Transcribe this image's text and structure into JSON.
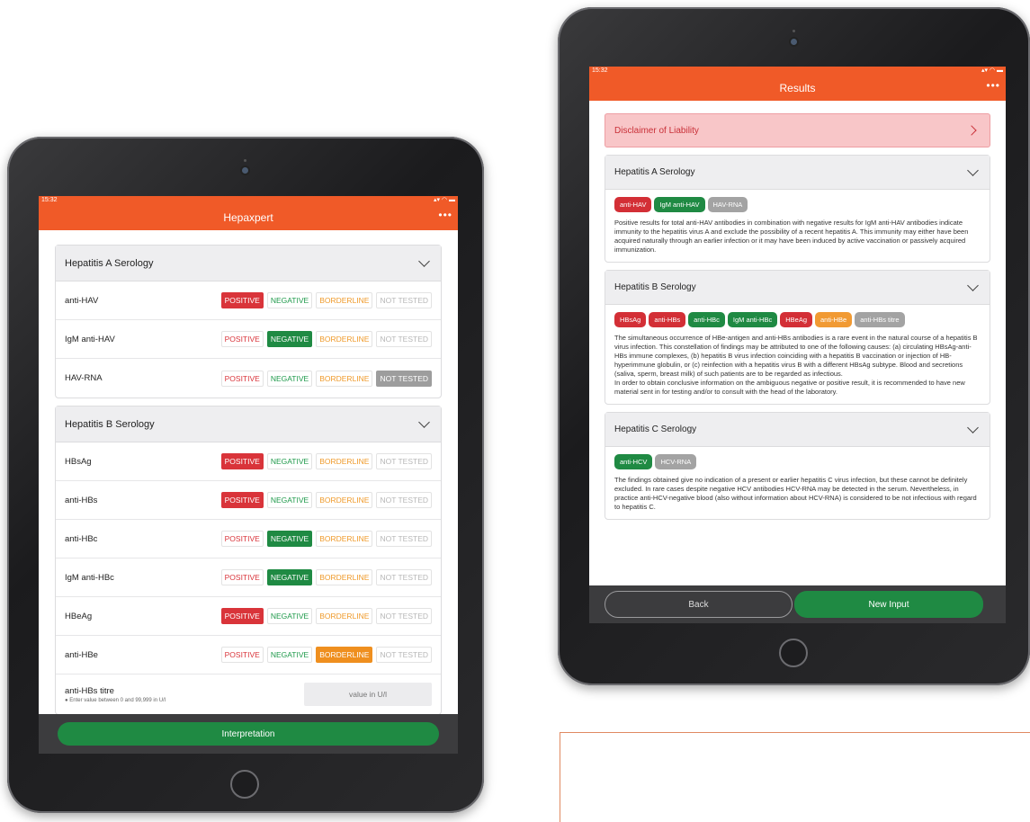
{
  "left_tablet": {
    "status_time": "15:32",
    "status_icons": "▴▾ ◠ ▬",
    "app_title": "Hepaxpert",
    "more_label": "•••",
    "options": [
      "POSITIVE",
      "NEGATIVE",
      "BORDERLINE",
      "NOT TESTED"
    ],
    "sections": [
      {
        "title": "Hepatitis A Serology",
        "rows": [
          {
            "label": "anti-HAV",
            "selected": "POSITIVE"
          },
          {
            "label": "IgM anti-HAV",
            "selected": "NEGATIVE"
          },
          {
            "label": "HAV-RNA",
            "selected": "NOT TESTED"
          }
        ]
      },
      {
        "title": "Hepatitis B Serology",
        "rows": [
          {
            "label": "HBsAg",
            "selected": "POSITIVE"
          },
          {
            "label": "anti-HBs",
            "selected": "POSITIVE"
          },
          {
            "label": "anti-HBc",
            "selected": "NEGATIVE"
          },
          {
            "label": "IgM anti-HBc",
            "selected": "NEGATIVE"
          },
          {
            "label": "HBeAg",
            "selected": "POSITIVE"
          },
          {
            "label": "anti-HBe",
            "selected": "BORDERLINE"
          }
        ],
        "titre": {
          "label": "anti-HBs titre",
          "hint": "Enter value between 0 and 99,999 in U/l",
          "placeholder": "value in U/l"
        }
      }
    ],
    "interpretation_button": "Interpretation"
  },
  "right_tablet": {
    "status_time": "15:32",
    "app_title": "Results",
    "more_label": "•••",
    "disclaimer": "Disclaimer of Liability",
    "results": [
      {
        "title": "Hepatitis A Serology",
        "tags": [
          {
            "text": "anti-HAV",
            "color": "red"
          },
          {
            "text": "IgM anti-HAV",
            "color": "green"
          },
          {
            "text": "HAV-RNA",
            "color": "grey"
          }
        ],
        "text": "Positive results for total anti-HAV antibodies in combination with negative results for IgM anti-HAV antibodies indicate immunity to the hepatitis virus A and exclude the possibility of a recent hepatitis A. This immunity may either have been acquired naturally through an earlier infection or it may have been induced by active vaccination or passively acquired immunization."
      },
      {
        "title": "Hepatitis B Serology",
        "tags": [
          {
            "text": "HBsAg",
            "color": "red"
          },
          {
            "text": "anti-HBs",
            "color": "red"
          },
          {
            "text": "anti-HBc",
            "color": "green"
          },
          {
            "text": "IgM anti-HBc",
            "color": "green"
          },
          {
            "text": "HBeAg",
            "color": "red"
          },
          {
            "text": "anti-HBe",
            "color": "orange"
          },
          {
            "text": "anti-HBs titre",
            "color": "grey"
          }
        ],
        "text": "The simultaneous occurrence of HBe-antigen and anti-HBs antibodies is a rare event in the natural course of a hepatitis B virus infection. This constellation of findings may be attributed to one of the following causes: (a) circulating HBsAg-anti-HBs immune complexes, (b) hepatitis B virus infection coinciding with a hepatitis B vaccination or injection of HB-hyperimmune globulin, or (c) reinfection with a hepatitis virus B with a different HBsAg subtype. Blood and secretions (saliva, sperm, breast milk) of such patients are to be regarded as infectious.",
        "text2": "In order to obtain conclusive information on the ambiguous negative or positive result, it is recommended to have new material sent in for testing and/or to consult with the head of the laboratory."
      },
      {
        "title": "Hepatitis C Serology",
        "tags": [
          {
            "text": "anti-HCV",
            "color": "green"
          },
          {
            "text": "HCV-RNA",
            "color": "grey"
          }
        ],
        "text": "The findings obtained give no indication of a present or earlier hepatitis C virus infection, but these cannot be definitely excluded. In rare cases despite negative HCV antibodies HCV-RNA may be detected in the serum. Nevertheless, in practice anti-HCV-negative blood (also without information about HCV-RNA) is considered to be not infectious with regard to hepatitis C."
      }
    ],
    "back_button": "Back",
    "new_input_button": "New Input"
  },
  "colors": {
    "brand_orange": "#f05a28",
    "positive_red": "#d32f36",
    "negative_green": "#1f8a43",
    "borderline_orange": "#ef8f1f",
    "not_tested_grey": "#9d9d9d"
  }
}
